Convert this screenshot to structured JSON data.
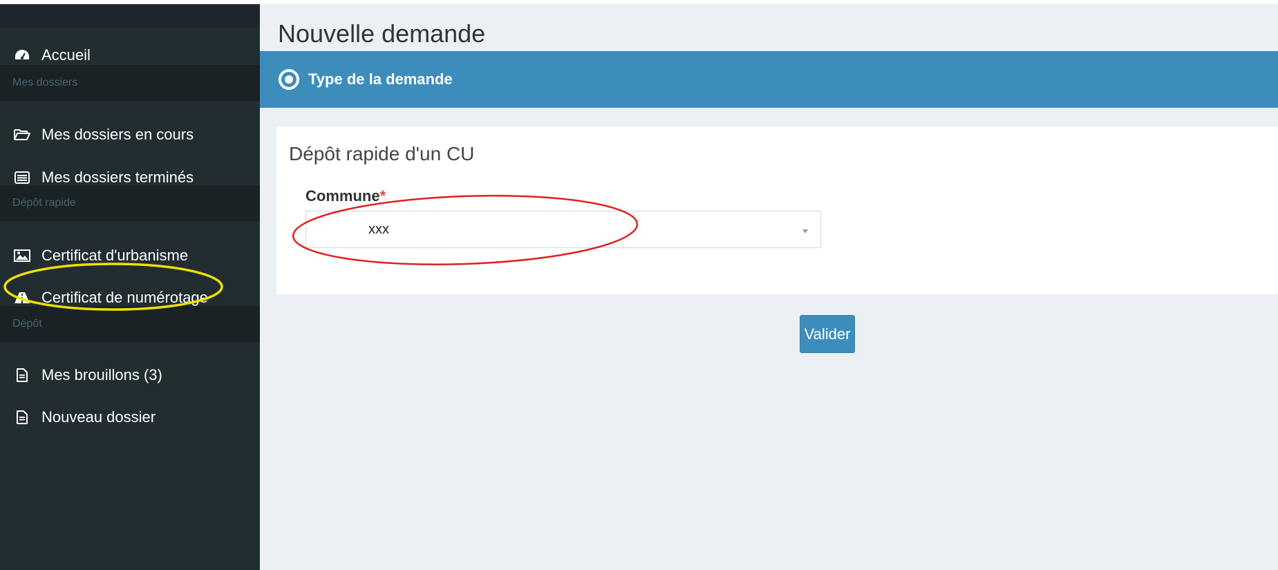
{
  "sidebar": {
    "accueil": {
      "label": "Accueil",
      "icon": "dashboard-icon"
    },
    "header_mes_dossiers": "Mes dossiers",
    "dossiers_en_cours": {
      "label": "Mes dossiers en cours",
      "icon": "folder-open-icon"
    },
    "dossiers_termines": {
      "label": "Mes dossiers terminés",
      "icon": "list-alt-icon"
    },
    "header_depot_rapide": "Dépôt rapide",
    "certificat_urbanisme": {
      "label": "Certificat d'urbanisme",
      "icon": "image-icon"
    },
    "certificat_numerotage": {
      "label": "Certificat de numérotage",
      "icon": "road-icon"
    },
    "header_depot": "Dépôt",
    "brouillons": {
      "label": "Mes brouillons (3)",
      "icon": "file-text-icon"
    },
    "nouveau_dossier": {
      "label": "Nouveau dossier",
      "icon": "file-text-icon"
    }
  },
  "main": {
    "page_title": "Nouvelle demande",
    "step_title": "Type de la demande",
    "step_icon": "dot-circle-icon",
    "box_title": "Dépôt rapide d'un CU",
    "commune_label": "Commune",
    "required_marker": "*",
    "commune_value": "xxx",
    "submit_label": "Valider"
  },
  "colors": {
    "sidebar_bg": "#222d32",
    "sidebar_header_bg": "#1a2226",
    "accent": "#3c8dbc",
    "content_bg": "#ecf0f5",
    "annotation_red": "#e02020",
    "annotation_yellow": "#f0e000"
  }
}
